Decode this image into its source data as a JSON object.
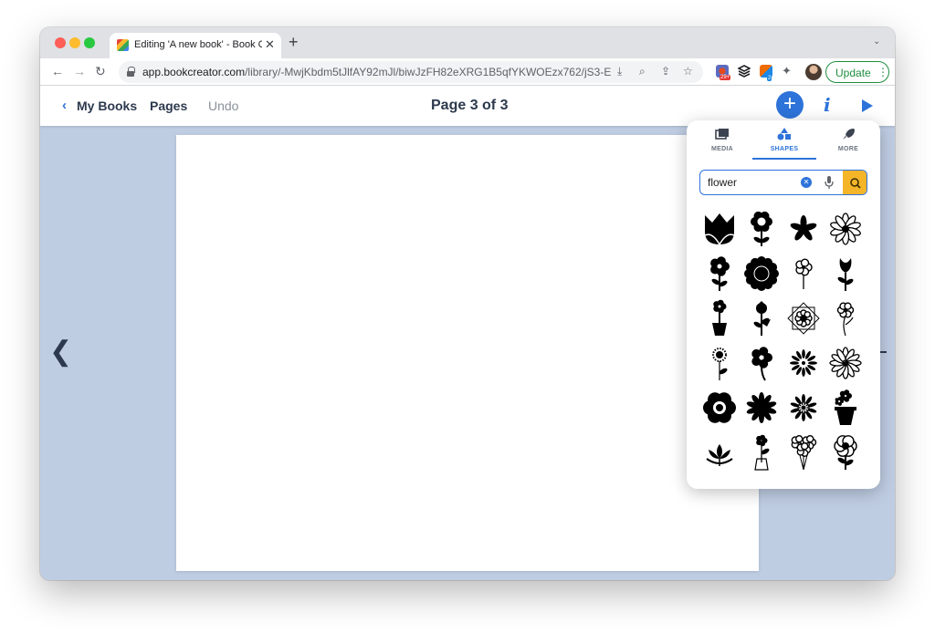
{
  "browser": {
    "tab_title": "Editing 'A new book' - Book Cr",
    "tab_close": "✕",
    "new_tab": "+",
    "tab_menu": "⌄",
    "url_host": "app.bookcreator.com",
    "url_path": "/library/-MwjKbdm5tJlfAY92mJl/biwJzFH82eXRG1B5qfYKWOEzx762/jS3-E...",
    "update_label": "Update",
    "update_menu": "⋮",
    "extension_badge": "29+",
    "extension_badge_2": "2"
  },
  "appbar": {
    "back_label": "My Books",
    "pages_label": "Pages",
    "undo_label": "Undo",
    "page_title": "Page 3 of 3",
    "add_symbol": "+",
    "info_symbol": "i"
  },
  "panel": {
    "tabs": [
      {
        "label": "MEDIA",
        "icon": "media-icon"
      },
      {
        "label": "SHAPES",
        "icon": "shapes-icon",
        "active": true
      },
      {
        "label": "MORE",
        "icon": "rocket-icon"
      }
    ],
    "search_value": "flower",
    "search_clear": "✕"
  },
  "shapes": [
    "tulip-icon",
    "flower-stem-icon",
    "asterisk-flower-icon",
    "daisy-outline-icon",
    "five-petal-stem-icon",
    "sunflower-bloom-icon",
    "doodle-flower-icon",
    "bud-stem-icon",
    "potted-flower-icon",
    "rose-leaves-icon",
    "mandala-flower-icon",
    "line-flower-icon",
    "small-sunflower-icon",
    "round-petal-flower-icon",
    "starburst-flower-icon",
    "daisy-petals-icon",
    "scalloped-flower-icon",
    "spiky-flower-icon",
    "dotted-burst-icon",
    "flower-pot-icon",
    "lotus-icon",
    "flower-vase-icon",
    "bouquet-icon",
    "poppy-icon"
  ],
  "colors": {
    "accent": "#2d73d9",
    "search_button": "#f4b528",
    "workspace": "#bfcde3",
    "update_green": "#1e8e3e"
  }
}
